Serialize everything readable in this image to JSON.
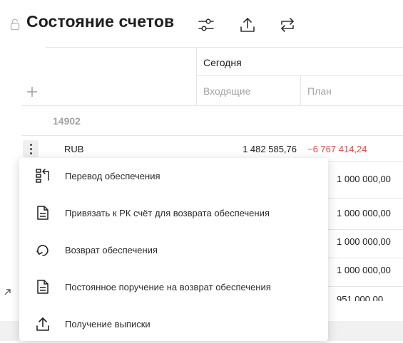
{
  "header": {
    "title": "Состояние счетов",
    "icons": [
      "lock-icon",
      "filter-sliders-icon",
      "upload-icon",
      "swap-arrows-icon"
    ]
  },
  "table": {
    "group_header": "Сегодня",
    "columns": [
      "Входящие",
      "План"
    ],
    "account_group": "14902",
    "rows": [
      {
        "currency": "RUB",
        "incoming": "1 482 585,76",
        "plan": "−6 767 414,24"
      },
      {
        "currency": "",
        "incoming": "",
        "plan": "1 000 000,00"
      },
      {
        "currency": "",
        "incoming": "",
        "plan": "1 000 000,00"
      },
      {
        "currency": "",
        "incoming": "",
        "plan": "1 000 000,00"
      },
      {
        "currency": "",
        "incoming": "",
        "plan": "1 000 000,00"
      },
      {
        "currency": "",
        "incoming": "",
        "plan": "951 000,00"
      }
    ]
  },
  "colors": {
    "negative": "#e8434a",
    "muted": "#a3a3a3",
    "divider": "#e6e6e6"
  },
  "menu": {
    "items": [
      {
        "label": "Перевод обеспечения",
        "icon": "transfer-icon"
      },
      {
        "label": "Привязать к РК счёт для возврата обеспечения",
        "icon": "document-icon"
      },
      {
        "label": "Возврат обеспечения",
        "icon": "return-arrow-icon"
      },
      {
        "label": "Постоянное поручение на возврат обеспечения",
        "icon": "document-icon"
      },
      {
        "label": "Получение выписки",
        "icon": "upload-icon"
      }
    ]
  }
}
